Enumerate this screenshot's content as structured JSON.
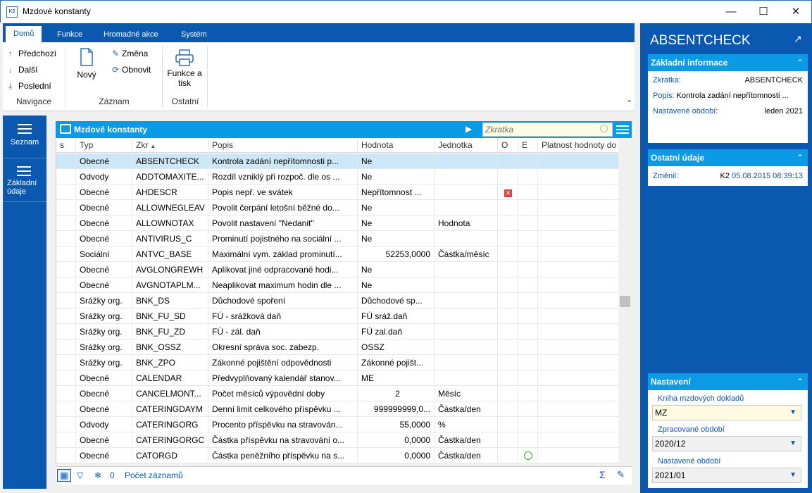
{
  "window": {
    "title": "Mzdové konstanty",
    "logo": "K2"
  },
  "ribbon": {
    "tabs": [
      "Domů",
      "Funkce",
      "Hromadné akce",
      "Systém"
    ],
    "nav": {
      "prev": "Předchozí",
      "next": "Další",
      "last": "Poslední",
      "group": "Navigace"
    },
    "record": {
      "new": "Nový",
      "change": "Změna",
      "refresh": "Obnovit",
      "group": "Záznam"
    },
    "other": {
      "print_line1": "Funkce a",
      "print_line2": "tisk",
      "group": "Ostatní"
    }
  },
  "leftnav": {
    "items": [
      {
        "label": "Seznam"
      },
      {
        "label_line1": "Základní",
        "label_line2": "údaje"
      }
    ]
  },
  "grid": {
    "title": "Mzdové konstanty",
    "search_placeholder": "Zkratka",
    "columns": [
      "s",
      "Typ",
      "Zkr",
      "Popis",
      "Hodnota",
      "Jednotka",
      "O",
      "E",
      "Platnost hodnoty do"
    ],
    "rows": [
      {
        "typ": "Obecné",
        "zkr": "ABSENTCHECK",
        "popis": "Kontrola zadání nepřítomnosti p...",
        "hodnota": "Ne",
        "jednotka": "",
        "num": false
      },
      {
        "typ": "Odvody",
        "zkr": "ADDTOMAXITE...",
        "popis": "Rozdíl vzniklý při rozpoč. dle os ...",
        "hodnota": "Ne",
        "jednotka": "",
        "num": false
      },
      {
        "typ": "Obecné",
        "zkr": "AHDESCR",
        "popis": "Popis nepř. ve svátek",
        "hodnota": "Nepřítomnost ...",
        "jednotka": "",
        "num": false,
        "o_flag": true
      },
      {
        "typ": "Obecné",
        "zkr": "ALLOWNEGLEAV",
        "popis": "Povolit čerpání letošní běžné do...",
        "hodnota": "Ne",
        "jednotka": "",
        "num": false
      },
      {
        "typ": "Obecné",
        "zkr": "ALLOWNOTAX",
        "popis": "Povolit nastavení \"Nedanit\"",
        "hodnota": "Ne",
        "jednotka": "Hodnota",
        "num": false
      },
      {
        "typ": "Obecné",
        "zkr": "ANTIVIRUS_C",
        "popis": "Prominutí pojistného na sociální ...",
        "hodnota": "Ne",
        "jednotka": "",
        "num": false
      },
      {
        "typ": "Sociální",
        "zkr": "ANTVC_BASE",
        "popis": "Maximální vym. základ prominutí...",
        "hodnota": "52253,0000",
        "jednotka": "Částka/měsíc",
        "num": true
      },
      {
        "typ": "Obecné",
        "zkr": "AVGLONGREWH",
        "popis": "Aplikovat jiné odpracované hodi...",
        "hodnota": "Ne",
        "jednotka": "",
        "num": false
      },
      {
        "typ": "Obecné",
        "zkr": "AVGNOTAPLM...",
        "popis": "Neaplikovat maximum hodin dle ...",
        "hodnota": "Ne",
        "jednotka": "",
        "num": false
      },
      {
        "typ": "Srážky org.",
        "zkr": "BNK_DS",
        "popis": "Důchodové spoření",
        "hodnota": "Důchodové sp...",
        "jednotka": "",
        "num": false
      },
      {
        "typ": "Srážky org.",
        "zkr": "BNK_FU_SD",
        "popis": "FÚ - srážková daň",
        "hodnota": "FÚ sráž.daň",
        "jednotka": "",
        "num": false
      },
      {
        "typ": "Srážky org.",
        "zkr": "BNK_FU_ZD",
        "popis": "FÚ - zál. daň",
        "hodnota": "FÚ zal.daň",
        "jednotka": "",
        "num": false
      },
      {
        "typ": "Srážky org.",
        "zkr": "BNK_OSSZ",
        "popis": "Okresní správa soc. zabezp.",
        "hodnota": "OSSZ",
        "jednotka": "",
        "num": false
      },
      {
        "typ": "Srážky org.",
        "zkr": "BNK_ZPO",
        "popis": "Zákonné pojištění odpovědnosti",
        "hodnota": "Zákonné pojišt...",
        "jednotka": "",
        "num": false
      },
      {
        "typ": "Obecné",
        "zkr": "CALENDAR",
        "popis": "Předvyplňovaný kalendář stanov...",
        "hodnota": "ME",
        "jednotka": "",
        "num": false
      },
      {
        "typ": "Obecné",
        "zkr": "CANCELMONT...",
        "popis": "Počet měsíců výpovědní doby",
        "hodnota": "2",
        "jednotka": "Měsíc",
        "num": true,
        "center": true
      },
      {
        "typ": "Obecné",
        "zkr": "CATERINGDAYM",
        "popis": "Denní limit celkového příspěvku ...",
        "hodnota": "999999999,0...",
        "jednotka": "Částka/den",
        "num": true
      },
      {
        "typ": "Odvody",
        "zkr": "CATERINGORG",
        "popis": "Procento příspěvku na stravován...",
        "hodnota": "55,0000",
        "jednotka": "%",
        "num": true
      },
      {
        "typ": "Obecné",
        "zkr": "CATERINGORGC",
        "popis": "Částka příspěvku na stravování o...",
        "hodnota": "0,0000",
        "jednotka": "Částka/den",
        "num": true
      },
      {
        "typ": "Obecné",
        "zkr": "CATORGD",
        "popis": "Částka peněžního příspěvku na s...",
        "hodnota": "0,0000",
        "jednotka": "Částka/den",
        "num": true,
        "e_flag": true
      }
    ]
  },
  "statusbar": {
    "filter_count": "0",
    "count_label": "Počet záznamů"
  },
  "right": {
    "title": "ABSENTCHECK",
    "basic": {
      "header": "Základní informace",
      "zkratka_label": "Zkratka:",
      "zkratka": "ABSENTCHECK",
      "popis_label": "Popis:",
      "popis": "Kontrola zadání nepřítomnosti ...",
      "obdobi_label": "Nastavené období:",
      "obdobi": "leden 2021"
    },
    "other": {
      "header": "Ostatní údaje",
      "changed_label": "Změnil:",
      "changed_user": "K2",
      "changed_date": "05.08.2015 08:39:13"
    },
    "settings": {
      "header": "Nastavení",
      "book_label": "Kniha mzdových dokladů",
      "book": "MZ",
      "processed_label": "Zpracované období",
      "processed": "2020/12",
      "set_label": "Nastavené období",
      "set": "2021/01"
    }
  }
}
